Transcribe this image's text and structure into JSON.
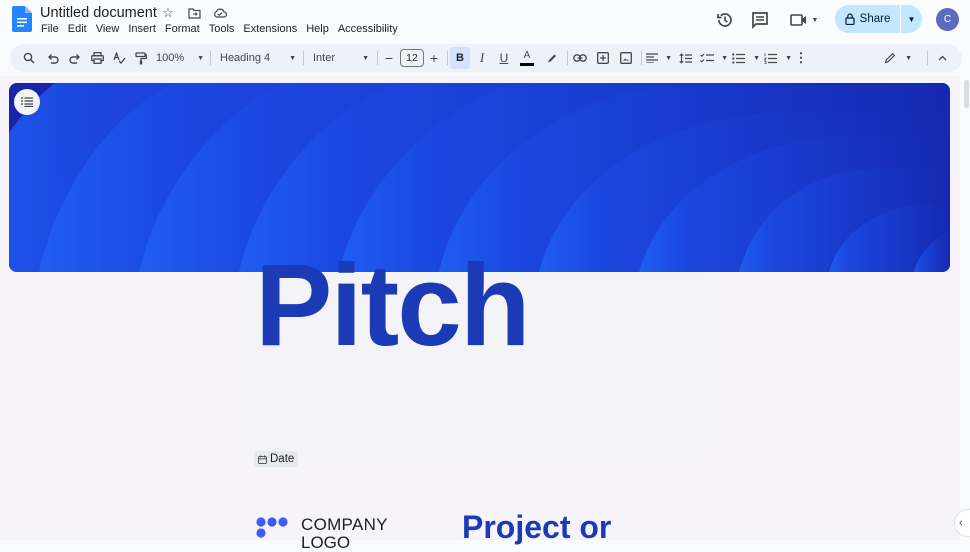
{
  "app": {
    "title": "Untitled document",
    "menu": [
      "File",
      "Edit",
      "View",
      "Insert",
      "Format",
      "Tools",
      "Extensions",
      "Help",
      "Accessibility"
    ],
    "title_icons": [
      "star-icon",
      "move-to-folder-icon",
      "cloud-saved-icon"
    ]
  },
  "header_right": {
    "share_label": "Share",
    "avatar_initial": "C",
    "icons": [
      "version-history-icon",
      "comments-icon",
      "meet-icon"
    ]
  },
  "toolbar": {
    "zoom": "100%",
    "style": "Heading 4",
    "font": "Inter",
    "font_size": "12",
    "minus": "−",
    "plus": "+",
    "bold": "B",
    "italic": "I",
    "underline": "U",
    "text_color_glyph": "A",
    "more": "⋮"
  },
  "document": {
    "title_text": "Pitch",
    "date_chip": "Date",
    "company_line1": "COMPANY",
    "company_line2": "LOGO",
    "project_heading": "Project or"
  },
  "colors": {
    "accent_blue": "#1a3bb5",
    "share_bg": "#c2e7ff",
    "avatar_bg": "#5c6bc0",
    "banner_base": "#1a2fc0",
    "banner_highlight": "#1f5cf0"
  }
}
